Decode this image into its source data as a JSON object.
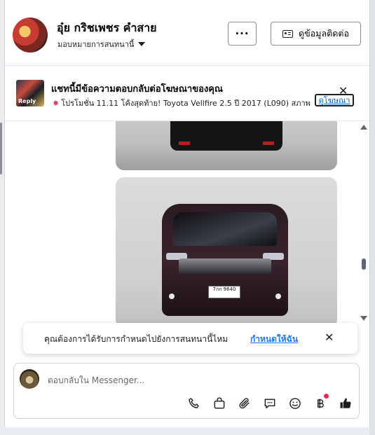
{
  "header": {
    "name": "อุ๋ย กริชเพชร คำสาย",
    "assign_label": "มอบหมายการสนทนานี้",
    "more_label": "···",
    "contact_label": "ดูข้อมูลติดต่อ"
  },
  "ad": {
    "thumb_text": "Reply",
    "title": "แชทนี้มีข้อความตอบกลับต่อโฆษณาของคุณ",
    "text": "โปรโมชั่น 11.11 โค้งสุดท้าย! Toyota Vellfire 2.5 ปี 2017 (L090) สภาพ",
    "link": "ดูโฆษณา",
    "close": "✕"
  },
  "messages": {
    "plate": "7กก 9640"
  },
  "prompt": {
    "text": "คุณต้องการได้รับการกำหนดไปยังการสนทนานี้ไหม",
    "link": "กำหนดให้ฉัน",
    "close": "✕"
  },
  "composer": {
    "placeholder": "ตอบกลับใน Messenger...",
    "icons": [
      "phone-icon",
      "bag-icon",
      "paperclip-icon",
      "chat-icon",
      "emoji-icon",
      "baht-icon",
      "thumbs-up-icon"
    ]
  },
  "colors": {
    "accent": "#1877f2",
    "link": "#0064d1",
    "notification": "#f02849"
  }
}
